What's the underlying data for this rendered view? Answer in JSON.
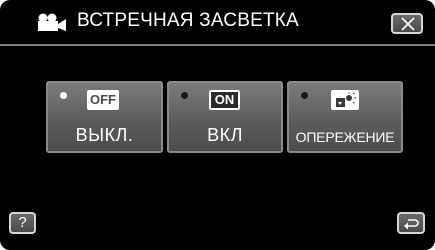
{
  "header": {
    "mode_icon": "movie-camera-icon",
    "title": "ВСТРЕЧНАЯ ЗАСВЕТКА",
    "close_icon": "close-icon"
  },
  "options": [
    {
      "id": "off",
      "badge": "OFF",
      "label": "ВЫКЛ.",
      "selected": true
    },
    {
      "id": "on",
      "badge": "ON",
      "label": "ВКЛ",
      "selected": false
    },
    {
      "id": "preemptive",
      "badge_icon": "backlight-compensation-icon",
      "label": "ОПЕРЕЖЕНИЕ",
      "selected": false
    }
  ],
  "footer": {
    "help_label": "?",
    "back_icon": "return-arrow-icon"
  },
  "colors": {
    "background": "#000000",
    "button": "#5d5d5d",
    "selected_dot": "#ffffff",
    "unselected_dot": "#1a1a1a"
  }
}
